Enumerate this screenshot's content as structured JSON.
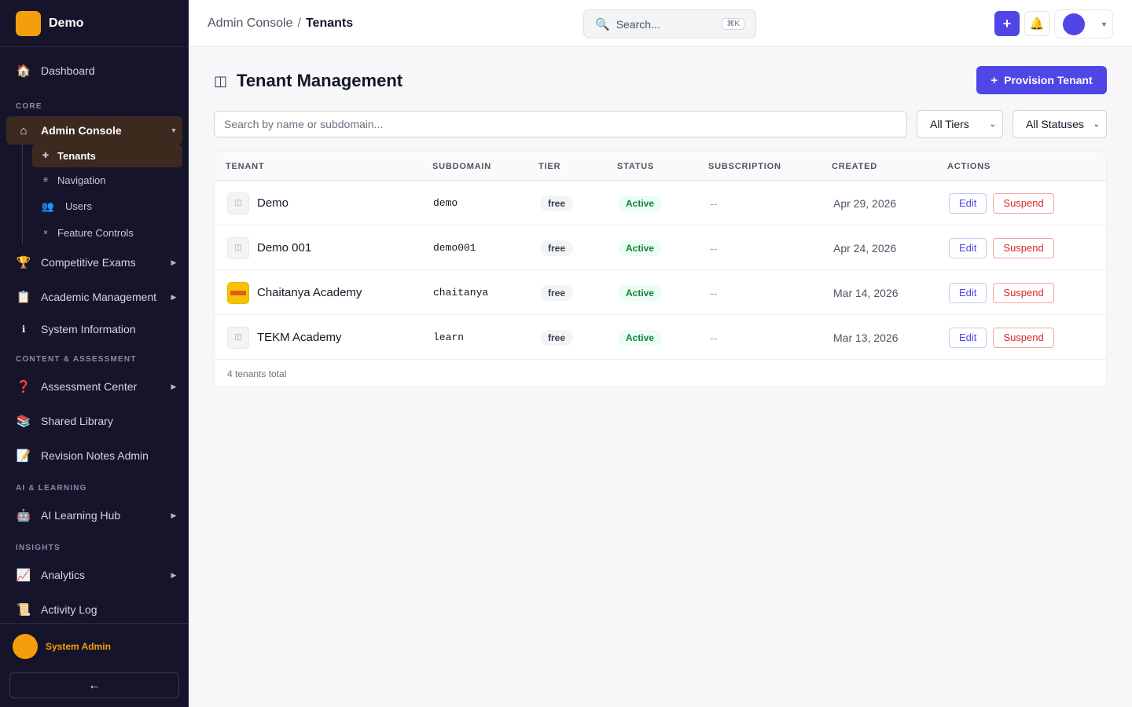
{
  "brand": {
    "name": "Demo"
  },
  "sidebar": {
    "top_items": [
      {
        "label": "Dashboard",
        "icon": "house-icon"
      }
    ],
    "sections": {
      "core": "CORE",
      "content": "CONTENT & ASSESSMENT",
      "ai": "AI & LEARNING",
      "insights": "INSIGHTS"
    },
    "admin_console": {
      "label": "Admin Console",
      "icon": "home-outline-icon"
    },
    "sub_items": [
      {
        "label": "Tenants",
        "icon": "plus-icon"
      },
      {
        "label": "Navigation",
        "icon": "menu-lines-icon"
      },
      {
        "label": "Users",
        "icon": "users-icon"
      },
      {
        "label": "Feature Controls",
        "icon": "x-icon"
      }
    ],
    "items": {
      "competitive_exams": "Competitive Exams",
      "academic_management": "Academic Management",
      "system_information": "System Information",
      "assessment_center": "Assessment Center",
      "shared_library": "Shared Library",
      "revision_notes_admin": "Revision Notes Admin",
      "ai_learning_hub": "AI Learning Hub",
      "analytics": "Analytics",
      "activity_log": "Activity Log"
    },
    "user_name": "System Admin",
    "collapse_glyph": "←"
  },
  "topbar": {
    "breadcrumb_parent": "Admin Console",
    "breadcrumb_sep": "/",
    "breadcrumb_current": "Tenants",
    "search_placeholder": "Search...",
    "search_shortcut": "⌘K",
    "plus_glyph": "+",
    "bell_glyph": "🔔",
    "profile_caret": "▼"
  },
  "page": {
    "title": "Tenant Management",
    "provision_button": "Provision Tenant",
    "provision_plus": "+"
  },
  "filters": {
    "search_placeholder": "Search by name or subdomain...",
    "tier_selected": "All Tiers",
    "status_selected": "All Statuses"
  },
  "table": {
    "headers": [
      "TENANT",
      "SUBDOMAIN",
      "TIER",
      "STATUS",
      "SUBSCRIPTION",
      "CREATED",
      "ACTIONS"
    ],
    "rows": [
      {
        "tenant": "Demo",
        "subdomain": "demo",
        "tier": "free",
        "status": "Active",
        "subscription": "--",
        "created": "Apr 29, 2026",
        "edit": "Edit",
        "suspend": "Suspend",
        "logo": false
      },
      {
        "tenant": "Demo 001",
        "subdomain": "demo001",
        "tier": "free",
        "status": "Active",
        "subscription": "--",
        "created": "Apr 24, 2026",
        "edit": "Edit",
        "suspend": "Suspend",
        "logo": false
      },
      {
        "tenant": "Chaitanya Academy",
        "subdomain": "chaitanya",
        "tier": "free",
        "status": "Active",
        "subscription": "--",
        "created": "Mar 14, 2026",
        "edit": "Edit",
        "suspend": "Suspend",
        "logo": true
      },
      {
        "tenant": "TEKM Academy",
        "subdomain": "learn",
        "tier": "free",
        "status": "Active",
        "subscription": "--",
        "created": "Mar 13, 2026",
        "edit": "Edit",
        "suspend": "Suspend",
        "logo": false
      }
    ],
    "footer": "4 tenants total"
  },
  "colors": {
    "sidebar_bg": "#16142b",
    "accent": "#4f46e5",
    "brand_orange": "#f59e0b",
    "active_status": "#15803d",
    "danger": "#dc2626"
  }
}
